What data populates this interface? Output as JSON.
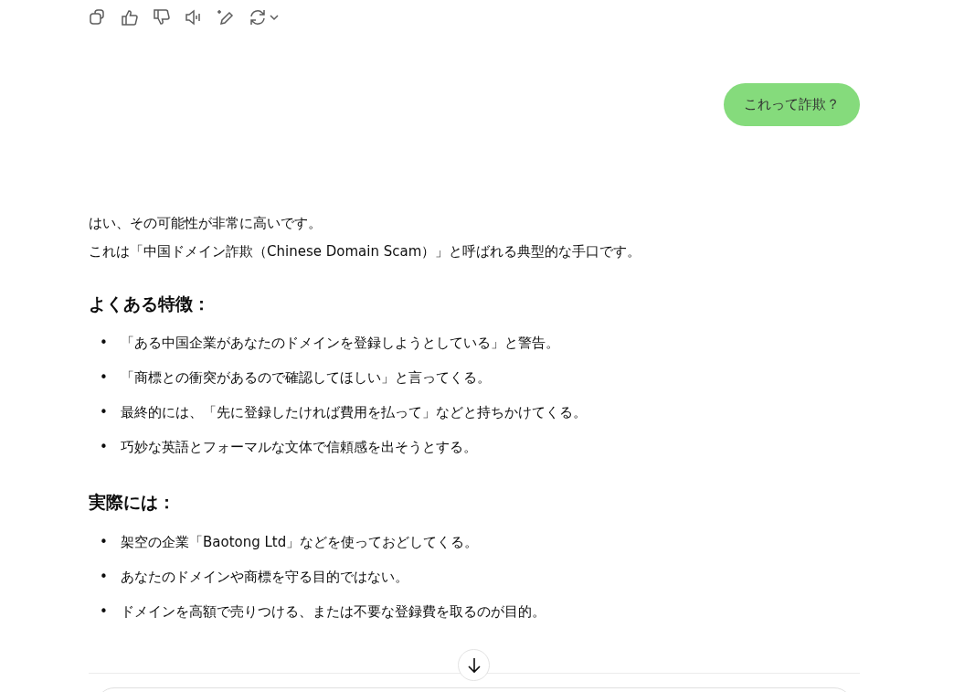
{
  "user_message": "これって詐欺？",
  "assistant_message": {
    "paragraphs": [
      "はい、その可能性が非常に高いです。",
      "これは「中国ドメイン詐欺（Chinese Domain Scam）」と呼ばれる典型的な手口です。"
    ],
    "sections": [
      {
        "heading": "よくある特徴：",
        "bullets": [
          {
            "marker": "•",
            "text": "「ある中国企業があなたのドメインを登録しようとしている」と警告。"
          },
          {
            "marker": "•",
            "text": "「商標との衝突があるので確認してほしい」と言ってくる。"
          },
          {
            "marker": "•",
            "text": "最終的には、「先に登録したければ費用を払って」などと持ちかけてくる。"
          },
          {
            "marker": "•",
            "text": "巧妙な英語とフォーマルな文体で信頼感を出そうとする。"
          }
        ]
      },
      {
        "heading": "実際には：",
        "bullets": [
          {
            "marker": "•",
            "text": "架空の企業「Baotong Ltd」などを使っておどしてくる。"
          },
          {
            "marker": "•",
            "text": "あなたのドメインや商標を守る目的ではない。"
          },
          {
            "marker": "•",
            "text": "ドメインを高額で売りつける、または不要な登録費を取るのが目的。"
          }
        ]
      }
    ]
  }
}
